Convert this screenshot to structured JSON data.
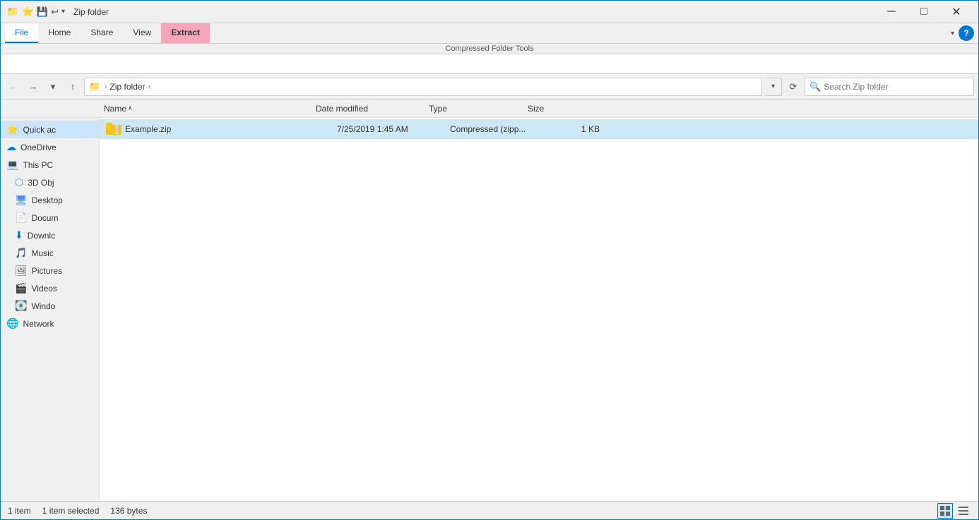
{
  "titlebar": {
    "title": "Zip folder",
    "minimize_label": "─",
    "maximize_label": "□",
    "close_label": "✕",
    "help_label": "?"
  },
  "ribbon": {
    "tabs": [
      {
        "id": "file",
        "label": "File"
      },
      {
        "id": "home",
        "label": "Home"
      },
      {
        "id": "share",
        "label": "Share"
      },
      {
        "id": "view",
        "label": "View"
      },
      {
        "id": "extract",
        "label": "Extract"
      }
    ],
    "tools_label": "Compressed Folder Tools",
    "active_tab": "extract"
  },
  "addressbar": {
    "back_label": "←",
    "forward_label": "→",
    "up_label": "↑",
    "recent_label": "▾",
    "refresh_label": "⟳",
    "path": [
      {
        "icon": "📁",
        "label": "Zip folder"
      }
    ],
    "path_text": "Zip folder",
    "search_placeholder": "Search Zip folder"
  },
  "columns": {
    "name": "Name",
    "name_sort": "∧",
    "date_modified": "Date modified",
    "type": "Type",
    "size": "Size"
  },
  "sidebar": {
    "quick_access_label": "Quick ac",
    "onedrive_label": "OneDrive",
    "thispc_label": "This PC",
    "items_thispc": [
      {
        "id": "3dobjects",
        "icon": "🎲",
        "label": "3D Obj"
      },
      {
        "id": "desktop",
        "icon": "🖥",
        "label": "Desktop"
      },
      {
        "id": "documents",
        "icon": "📄",
        "label": "Docum"
      },
      {
        "id": "downloads",
        "icon": "⬇",
        "label": "Downlc"
      },
      {
        "id": "music",
        "icon": "🎵",
        "label": "Music"
      },
      {
        "id": "pictures",
        "icon": "🖼",
        "label": "Pictures"
      },
      {
        "id": "videos",
        "icon": "🎬",
        "label": "Videos"
      },
      {
        "id": "windows",
        "icon": "💻",
        "label": "Windo"
      }
    ],
    "network_label": "Network"
  },
  "files": [
    {
      "name": "Example.zip",
      "date_modified": "7/25/2019 1:45 AM",
      "type": "Compressed (zipp...",
      "size": "1 KB",
      "selected": true
    }
  ],
  "statusbar": {
    "item_count": "1 item",
    "selected_count": "1 item selected",
    "selected_size": "136 bytes",
    "view_details_label": "⊞",
    "view_list_label": "≡"
  }
}
